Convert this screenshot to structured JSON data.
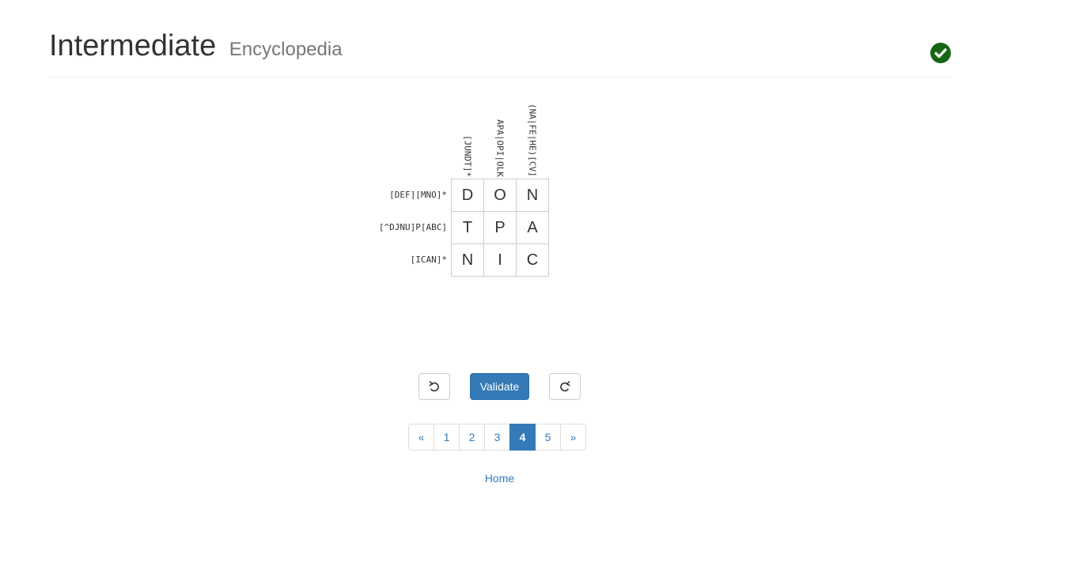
{
  "header": {
    "title": "Intermediate",
    "subtitle": "Encyclopedia",
    "status_icon": "check-circle-icon",
    "status_color": "#156615"
  },
  "puzzle": {
    "column_clues": [
      "[JUNDT]*",
      "APA|OPI|OLK",
      "(NA|FE|HE)[CV]"
    ],
    "row_clues": [
      "[DEF][MNO]*",
      "[^DJNU]P[ABC]",
      "[ICAN]*"
    ],
    "grid": [
      [
        "D",
        "O",
        "N"
      ],
      [
        "T",
        "P",
        "A"
      ],
      [
        "N",
        "I",
        "C"
      ]
    ]
  },
  "controls": {
    "undo_icon": "undo-icon",
    "validate_label": "Validate",
    "redo_icon": "redo-icon"
  },
  "pagination": {
    "prev": "«",
    "pages": [
      "1",
      "2",
      "3",
      "4",
      "5"
    ],
    "active_page": "4",
    "next": "»"
  },
  "footer": {
    "home_label": "Home"
  },
  "colors": {
    "primary": "#337ab7",
    "border": "#cccccc"
  }
}
